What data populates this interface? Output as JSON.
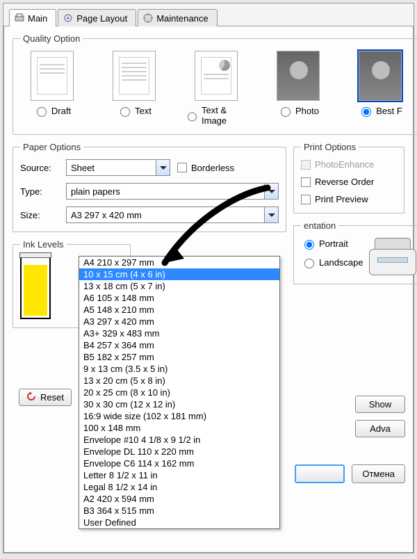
{
  "tabs": {
    "main": "Main",
    "layout": "Page Layout",
    "maint": "Maintenance"
  },
  "quality": {
    "legend": "Quality Option",
    "items": [
      {
        "label": "Draft",
        "checked": false
      },
      {
        "label": "Text",
        "checked": false
      },
      {
        "label": "Text & Image",
        "checked": false
      },
      {
        "label": "Photo",
        "checked": false
      },
      {
        "label": "Best F",
        "checked": true
      }
    ]
  },
  "paper": {
    "legend": "Paper Options",
    "source_label": "Source:",
    "source_value": "Sheet",
    "borderless": "Borderless",
    "type_label": "Type:",
    "type_value": "plain papers",
    "size_label": "Size:",
    "size_value": "A3 297 x 420 mm",
    "size_options": [
      "A4 210 x 297 mm",
      "10 x 15 cm (4 x 6 in)",
      "13 x 18 cm (5 x 7 in)",
      "A6 105 x 148 mm",
      "A5 148 x 210 mm",
      "A3 297 x 420 mm",
      "A3+ 329 x 483 mm",
      "B4 257 x 364 mm",
      "B5 182 x 257 mm",
      "9 x 13 cm (3.5 x 5 in)",
      "13 x 20 cm (5 x 8 in)",
      "20 x 25 cm (8 x 10 in)",
      "30 x 30 cm (12 x 12 in)",
      "16:9 wide size (102 x 181 mm)",
      "100 x 148 mm",
      "Envelope #10 4 1/8 x 9 1/2 in",
      "Envelope DL 110 x 220 mm",
      "Envelope C6 114 x 162 mm",
      "Letter 8 1/2 x 11 in",
      "Legal 8 1/2 x 14 in",
      "A2 420 x 594 mm",
      "B3 364 x 515 mm",
      "User Defined"
    ],
    "size_highlight_index": 1
  },
  "print_options": {
    "legend": "Print Options",
    "photoenhance": "PhotoEnhance",
    "reverse": "Reverse Order",
    "preview": "Print Preview"
  },
  "ink": {
    "legend": "Ink Levels"
  },
  "orientation": {
    "legend_partial": "entation",
    "portrait": "Portrait",
    "landscape": "Landscape"
  },
  "buttons": {
    "show": "Show",
    "adva": "Adva",
    "reset": "Reset",
    "cancel": "Отмена"
  }
}
